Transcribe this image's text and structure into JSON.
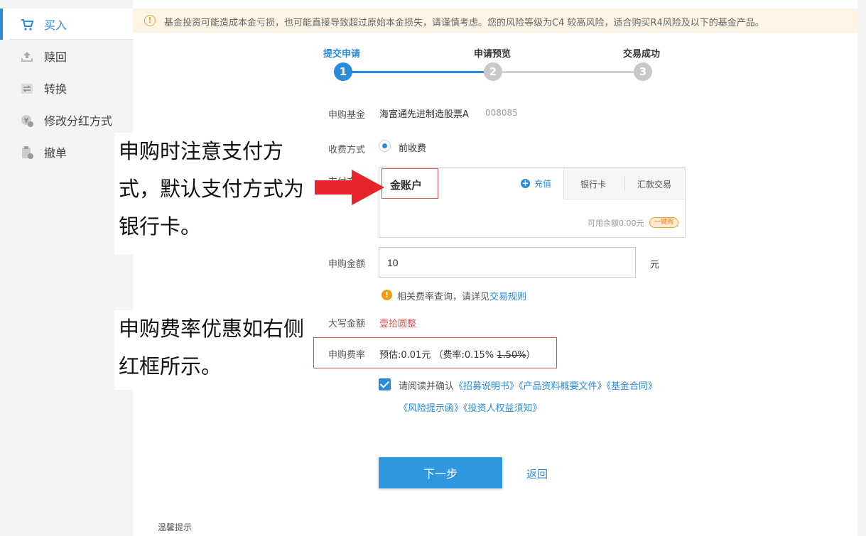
{
  "sidebar": {
    "items": [
      {
        "label": "买入",
        "icon": "cart-icon",
        "active": true
      },
      {
        "label": "赎回",
        "icon": "upload-icon"
      },
      {
        "label": "转换",
        "icon": "exchange-icon"
      },
      {
        "label": "修改分红方式",
        "icon": "yen-gear-icon"
      },
      {
        "label": "撤单",
        "icon": "clipboard-cancel-icon"
      }
    ]
  },
  "notice": {
    "text": "基金投资可能造成本金亏损，也可能直接导致超过原始本金损失，请谨慎考虑。您的风险等级为C4 较高风险，适合购买R4风险及以下的基金产品。"
  },
  "steps": [
    {
      "number": "1",
      "label": "提交申请",
      "active": true
    },
    {
      "number": "2",
      "label": "申请预览"
    },
    {
      "number": "3",
      "label": "交易成功"
    }
  ],
  "form": {
    "fund_label": "申购基金",
    "fund_name": "海富通先进制造股票A",
    "fund_code": "008085",
    "fee_mode_label": "收费方式",
    "fee_mode_value": "前收费",
    "pay_label_partial": "支付方式",
    "pay_selected": "金账户",
    "recharge": "充值",
    "tab_bank": "银行卡",
    "tab_remit": "汇款交易",
    "balance": "可用余额0.00元",
    "one_click": "一键购",
    "amount_label": "申购金额",
    "amount_value": "10",
    "unit": "元",
    "fee_query_text": "相关费率查询，请详见",
    "fee_query_link": "交易规则",
    "daxie_label": "大写金额",
    "daxie_value": "壹拾圆整",
    "fee_label": "申购费率",
    "fee_estimate": "预估:0.01元",
    "fee_rate_prefix": "（费率:0.15%",
    "fee_original": "1.50%",
    "fee_rate_suffix": "）",
    "agree_prefix": "请阅读并确认",
    "docs": [
      "《招募说明书》",
      "《产品资料概要文件》",
      "《基金合同》",
      "《风险提示函》",
      "《投资人权益须知》"
    ],
    "next_button": "下一步",
    "back": "返回",
    "tips": "温馨提示"
  },
  "annotations": {
    "note1": "申购时注意支付方式，默认支付方式为银行卡。",
    "note2": "申购费率优惠如右侧红框所示。"
  },
  "colors": {
    "accent": "#2a8bd9",
    "highlight_red": "#d9534f",
    "arrow_red": "#e8242a",
    "notice_bg": "#fdf4e6"
  }
}
